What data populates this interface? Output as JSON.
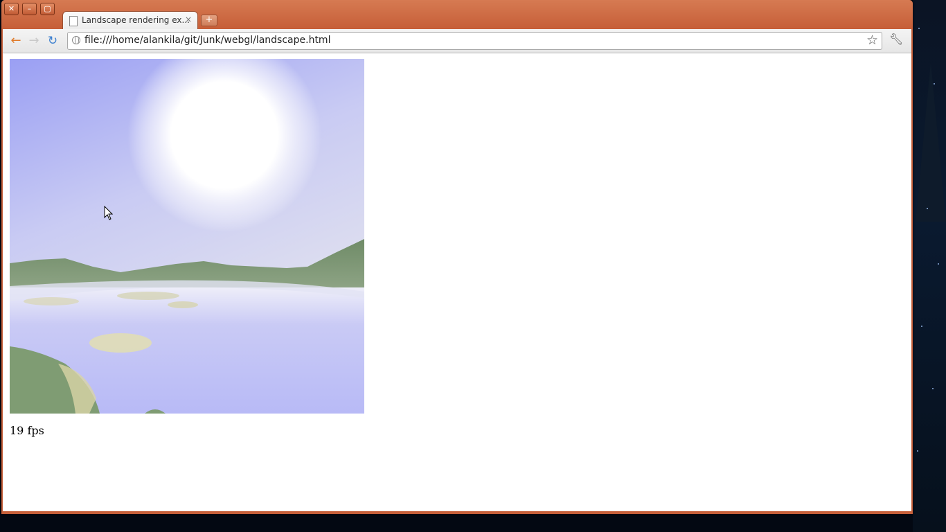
{
  "browser": {
    "tab_title": "Landscape rendering ex...",
    "tab_close": "×",
    "new_tab": "+",
    "address": "file:///home/alankila/git/Junk/webgl/landscape.html",
    "nav": {
      "back": "←",
      "forward": "→",
      "reload": "↻"
    },
    "window_controls": {
      "close": "✕",
      "minimize": "–",
      "maximize": "▢"
    },
    "bookmark_icon": "star-icon",
    "menu_icon": "wrench-icon"
  },
  "page": {
    "fps_label": "19 fps"
  },
  "colors": {
    "titlebar": "#c65e38",
    "sky_top": "#9ea3f4",
    "sun": "#ffffff",
    "water": "#c7c8f6",
    "hills": "#7f9a73"
  }
}
